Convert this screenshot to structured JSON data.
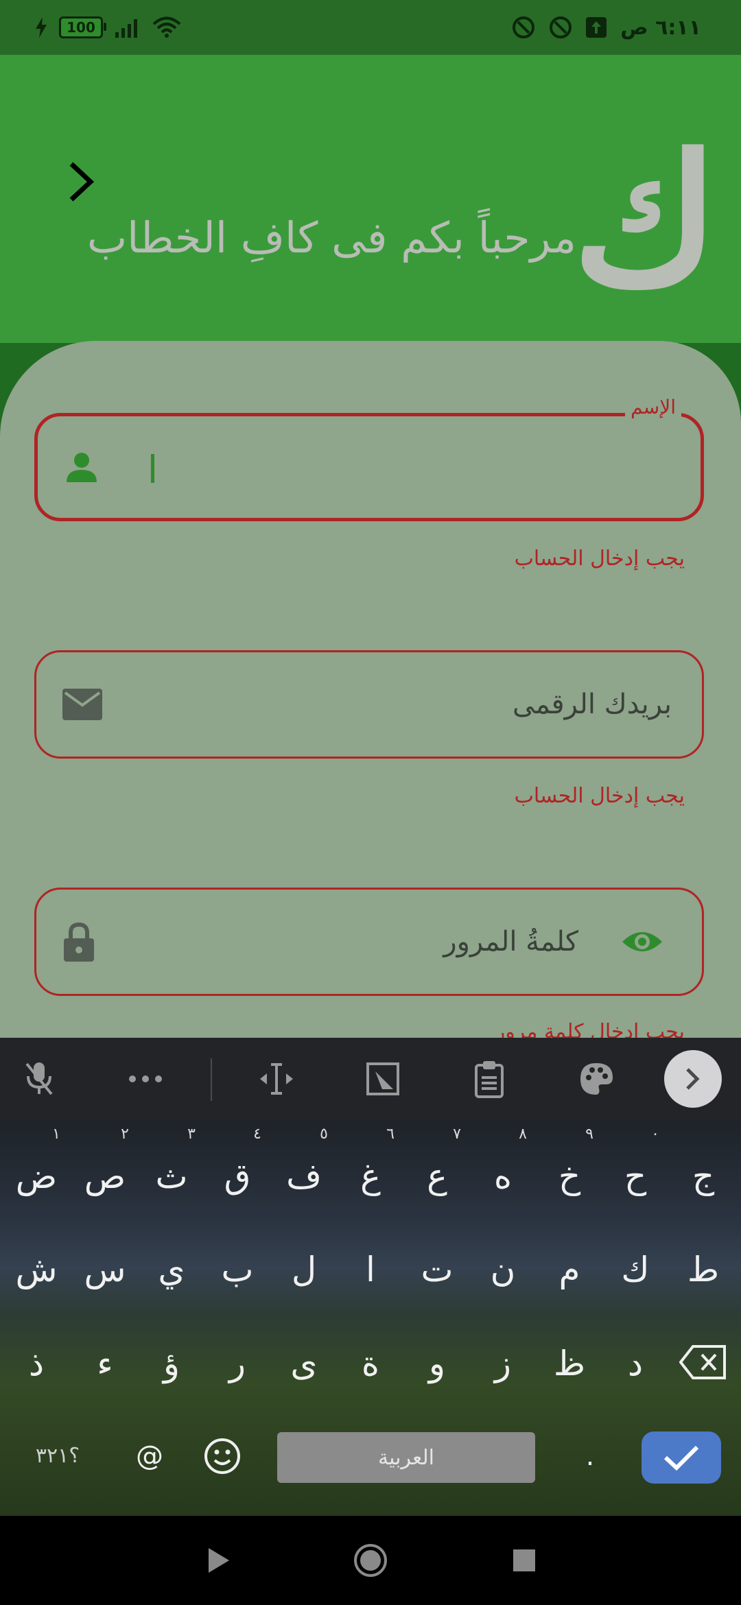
{
  "status_bar": {
    "battery": "100",
    "time": "٦:١١ ص"
  },
  "header": {
    "logo": "ك",
    "welcome": "مرحباً بكم فى كافِ الخطاب"
  },
  "form": {
    "name": {
      "label": "الإسم",
      "value": "",
      "error": "يجب إدخال الحساب"
    },
    "email": {
      "placeholder": "بريدك الرقمى",
      "error": "يجب إدخال الحساب"
    },
    "password": {
      "placeholder": "كلمةُ المرور",
      "error": "يجب إدخال كلمة مرور"
    }
  },
  "keyboard": {
    "row1": [
      {
        "k": "ض",
        "h": "١"
      },
      {
        "k": "ص",
        "h": "٢"
      },
      {
        "k": "ث",
        "h": "٣"
      },
      {
        "k": "ق",
        "h": "٤"
      },
      {
        "k": "ف",
        "h": "٥"
      },
      {
        "k": "غ",
        "h": "٦"
      },
      {
        "k": "ع",
        "h": "٧"
      },
      {
        "k": "ه",
        "h": "٨"
      },
      {
        "k": "خ",
        "h": "٩"
      },
      {
        "k": "ح",
        "h": "٠"
      },
      {
        "k": "ج",
        "h": ""
      }
    ],
    "row2": [
      "ش",
      "س",
      "ي",
      "ب",
      "ل",
      "ا",
      "ت",
      "ن",
      "م",
      "ك",
      "ط"
    ],
    "row3": [
      "ذ",
      "ء",
      "ؤ",
      "ر",
      "ى",
      "ة",
      "و",
      "ز",
      "ظ",
      "د"
    ],
    "symbols_key": "؟٣٢١",
    "at_key": "@",
    "space_label": "العربية",
    "period_key": "."
  }
}
